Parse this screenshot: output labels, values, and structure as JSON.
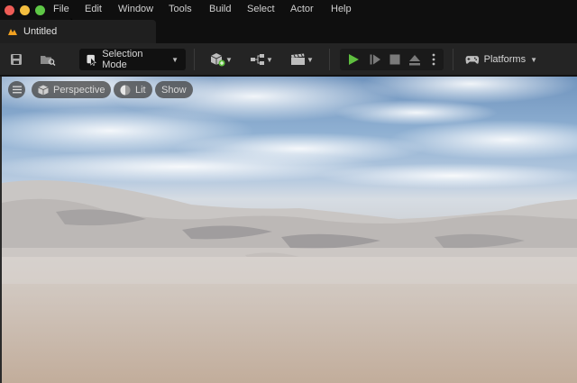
{
  "menubar": {
    "items": [
      "File",
      "Edit",
      "Window",
      "Tools",
      "Build",
      "Select",
      "Actor",
      "Help"
    ]
  },
  "tab": {
    "title": "Untitled",
    "icon": "unreal-level-icon"
  },
  "toolbar": {
    "selection_mode_label": "Selection Mode",
    "platforms_label": "Platforms",
    "play_color": "#5fbf3f"
  },
  "viewport": {
    "perspective_label": "Perspective",
    "lit_label": "Lit",
    "show_label": "Show"
  },
  "colors": {
    "traffic_red": "#ee5c56",
    "traffic_yellow": "#f4be3f",
    "traffic_green": "#5ec746",
    "accent_orange": "#f0a020"
  }
}
